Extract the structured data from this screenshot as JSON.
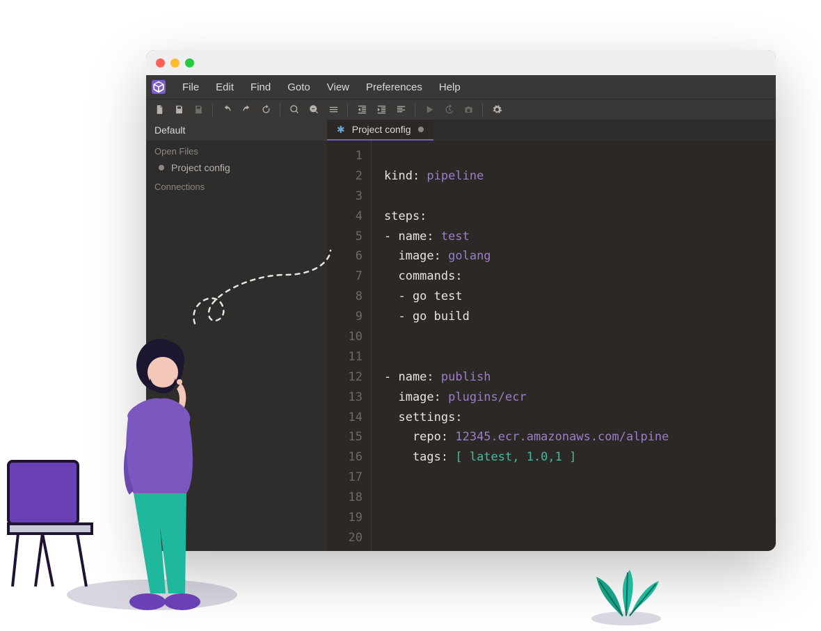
{
  "menubar": {
    "items": [
      "File",
      "Edit",
      "Find",
      "Goto",
      "View",
      "Preferences",
      "Help"
    ]
  },
  "toolbar": {
    "icons": [
      {
        "name": "new-file-icon",
        "dim": false
      },
      {
        "name": "save-icon",
        "dim": false
      },
      {
        "name": "save-all-icon",
        "dim": true
      },
      {
        "sep": true
      },
      {
        "name": "undo-icon",
        "dim": false
      },
      {
        "name": "redo-icon",
        "dim": false
      },
      {
        "name": "refresh-icon",
        "dim": false
      },
      {
        "sep": true
      },
      {
        "name": "search-icon",
        "dim": false
      },
      {
        "name": "search-replace-icon",
        "dim": false
      },
      {
        "name": "menu-icon",
        "dim": false
      },
      {
        "sep": true
      },
      {
        "name": "outdent-icon",
        "dim": false
      },
      {
        "name": "indent-icon",
        "dim": false
      },
      {
        "name": "align-left-icon",
        "dim": false
      },
      {
        "sep": true
      },
      {
        "name": "play-icon",
        "dim": true
      },
      {
        "name": "history-icon",
        "dim": true
      },
      {
        "name": "camera-icon",
        "dim": true
      },
      {
        "sep": true
      },
      {
        "name": "settings-icon",
        "dim": false
      }
    ]
  },
  "sidebar": {
    "header": "Default",
    "section_open": "Open Files",
    "open_files": [
      {
        "label": "Project config"
      }
    ],
    "section_conn": "Connections"
  },
  "tabs": [
    {
      "label": "Project config",
      "modified": true
    }
  ],
  "code": {
    "line_count": 20,
    "lines": [
      {
        "n": 1,
        "segments": []
      },
      {
        "n": 2,
        "segments": [
          {
            "t": "kind: ",
            "c": "tok-key"
          },
          {
            "t": "pipeline",
            "c": "tok-val"
          }
        ]
      },
      {
        "n": 3,
        "segments": []
      },
      {
        "n": 4,
        "segments": [
          {
            "t": "steps:",
            "c": "tok-key"
          }
        ]
      },
      {
        "n": 5,
        "segments": [
          {
            "t": "- name: ",
            "c": "tok-key"
          },
          {
            "t": "test",
            "c": "tok-val"
          }
        ]
      },
      {
        "n": 6,
        "segments": [
          {
            "t": "  image: ",
            "c": "tok-key"
          },
          {
            "t": "golang",
            "c": "tok-val"
          }
        ]
      },
      {
        "n": 7,
        "segments": [
          {
            "t": "  commands:",
            "c": "tok-key"
          }
        ]
      },
      {
        "n": 8,
        "segments": [
          {
            "t": "  - go test",
            "c": "tok-key"
          }
        ]
      },
      {
        "n": 9,
        "segments": [
          {
            "t": "  - go build",
            "c": "tok-key"
          }
        ]
      },
      {
        "n": 10,
        "segments": []
      },
      {
        "n": 11,
        "segments": []
      },
      {
        "n": 12,
        "segments": [
          {
            "t": "- name: ",
            "c": "tok-key"
          },
          {
            "t": "publish",
            "c": "tok-val"
          }
        ]
      },
      {
        "n": 13,
        "segments": [
          {
            "t": "  image: ",
            "c": "tok-key"
          },
          {
            "t": "plugins/ecr",
            "c": "tok-val"
          }
        ]
      },
      {
        "n": 14,
        "segments": [
          {
            "t": "  settings:",
            "c": "tok-key"
          }
        ]
      },
      {
        "n": 15,
        "segments": [
          {
            "t": "    repo: ",
            "c": "tok-key"
          },
          {
            "t": "12345.ecr.amazonaws.com/alpine",
            "c": "tok-val"
          }
        ]
      },
      {
        "n": 16,
        "segments": [
          {
            "t": "    tags: ",
            "c": "tok-key"
          },
          {
            "t": "[ latest, 1.0,1 ]",
            "c": "tok-arr"
          }
        ]
      },
      {
        "n": 17,
        "segments": []
      },
      {
        "n": 18,
        "segments": []
      },
      {
        "n": 19,
        "segments": []
      },
      {
        "n": 20,
        "segments": []
      }
    ]
  }
}
